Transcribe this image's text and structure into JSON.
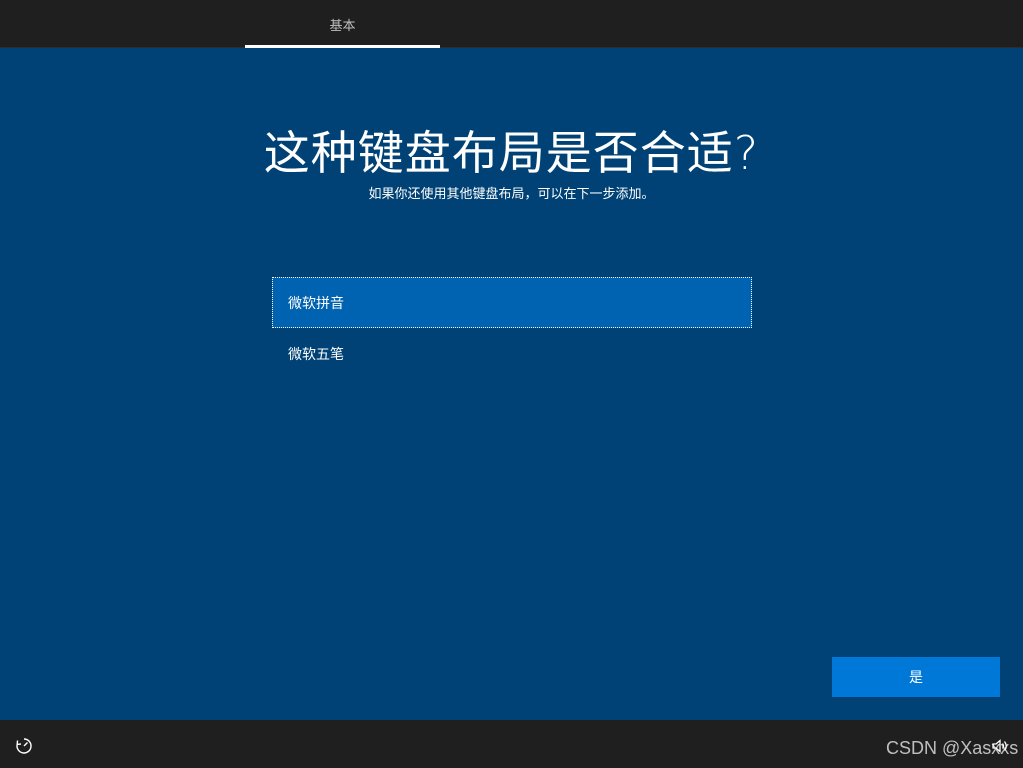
{
  "header": {
    "tabs": [
      {
        "label": "基本",
        "active": true
      }
    ]
  },
  "main": {
    "title": "这种键盘布局是否合适?",
    "subtitle": "如果你还使用其他键盘布局，可以在下一步添加。",
    "layouts": [
      {
        "label": "微软拼音",
        "selected": true
      },
      {
        "label": "微软五笔",
        "selected": false
      }
    ],
    "confirm_label": "是"
  },
  "footer": {
    "left_icon": "ease-of-access-icon",
    "right_icon": "volume-icon",
    "watermark": "CSDN @Xasxxs"
  },
  "colors": {
    "background": "#004275",
    "bar": "#1f1f1f",
    "selected_item": "#0063b1",
    "button": "#0078d7"
  }
}
